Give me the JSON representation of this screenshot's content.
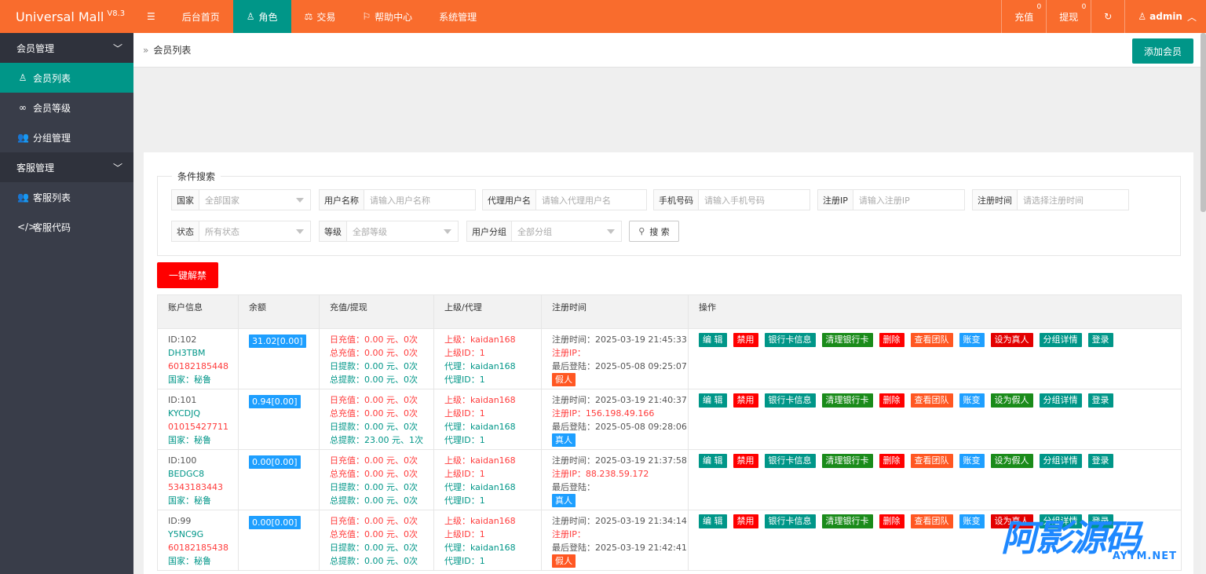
{
  "app": {
    "name": "Universal Mall",
    "version": "V8.3"
  },
  "topnav": {
    "menu_icon": "menu-icon",
    "items": [
      {
        "label": "后台首页",
        "active": false,
        "icon": ""
      },
      {
        "label": "角色",
        "active": true,
        "icon": "user-icon"
      },
      {
        "label": "交易",
        "active": false,
        "icon": "scale-icon"
      },
      {
        "label": "帮助中心",
        "active": false,
        "icon": "flag-icon"
      },
      {
        "label": "系统管理",
        "active": false,
        "icon": ""
      }
    ],
    "right": {
      "recharge_label": "充值",
      "recharge_count": "0",
      "withdraw_label": "提现",
      "withdraw_count": "0",
      "refresh_icon": "refresh-icon",
      "user_label": "admin"
    }
  },
  "sidebar": {
    "groups": [
      {
        "label": "会员管理",
        "items": [
          {
            "label": "会员列表",
            "icon": "user-icon",
            "active": true
          },
          {
            "label": "会员等级",
            "icon": "link-icon",
            "active": false
          },
          {
            "label": "分组管理",
            "icon": "users-icon",
            "active": false
          }
        ]
      },
      {
        "label": "客服管理",
        "items": [
          {
            "label": "客服列表",
            "icon": "users-icon",
            "active": false
          },
          {
            "label": "客服代码",
            "icon": "code-icon",
            "active": false
          }
        ]
      }
    ]
  },
  "breadcrumb": {
    "current": "会员列表"
  },
  "add_member_label": "添加会员",
  "search": {
    "legend": "条件搜索",
    "country": {
      "label": "国家",
      "value": "全部国家"
    },
    "username": {
      "label": "用户名称",
      "placeholder": "请输入用户名称"
    },
    "agent": {
      "label": "代理用户名",
      "placeholder": "请输入代理用户名"
    },
    "phone": {
      "label": "手机号码",
      "placeholder": "请输入手机号码"
    },
    "regip": {
      "label": "注册IP",
      "placeholder": "请输入注册IP"
    },
    "regtime": {
      "label": "注册时间",
      "placeholder": "请选择注册时间"
    },
    "status": {
      "label": "状态",
      "value": "所有状态"
    },
    "level": {
      "label": "等级",
      "value": "全部等级"
    },
    "group": {
      "label": "用户分组",
      "value": "全部分组"
    },
    "button": "搜 索"
  },
  "unban_label": "一键解禁",
  "table": {
    "headers": [
      "账户信息",
      "余额",
      "充值/提现",
      "上级/代理",
      "注册时间",
      "操作"
    ],
    "rows": [
      {
        "id": "ID:102",
        "username": "DH3TBM",
        "phone": "60182185448",
        "country": "国家：秘鲁",
        "balance": "31.02[0.00]",
        "day_recharge": "日充值：0.00 元、0次",
        "total_recharge": "总充值：0.00 元、0次",
        "day_withdraw": "日提款：0.00 元、0次",
        "total_withdraw": "总提款：0.00 元、0次",
        "parent": "上级：kaidan168",
        "parent_id": "上级ID：1",
        "agent": "代理：kaidan168",
        "agent_id": "代理ID：1",
        "reg_time": "注册时间：2025-03-19 21:45:33",
        "reg_ip": "注册IP：",
        "last_login": "最后登陆：2025-05-08 09:25:07",
        "type_tag": "假人",
        "type": "fake",
        "ops": [
          "编 辑",
          "禁用",
          "银行卡信息",
          "清理银行卡",
          "删除",
          "查看团队",
          "账变",
          "设为真人",
          "分组详情",
          "登录"
        ]
      },
      {
        "id": "ID:101",
        "username": "KYCDJQ",
        "phone": "01015427711",
        "country": "国家：秘鲁",
        "balance": "0.94[0.00]",
        "day_recharge": "日充值：0.00 元、0次",
        "total_recharge": "总充值：0.00 元、0次",
        "day_withdraw": "日提款：0.00 元、0次",
        "total_withdraw": "总提款：23.00 元、1次",
        "parent": "上级：kaidan168",
        "parent_id": "上级ID：1",
        "agent": "代理：kaidan168",
        "agent_id": "代理ID：1",
        "reg_time": "注册时间：2025-03-19 21:40:37",
        "reg_ip": "注册IP：156.198.49.166",
        "last_login": "最后登陆：2025-05-08 09:28:06",
        "type_tag": "真人",
        "type": "real",
        "ops": [
          "编 辑",
          "禁用",
          "银行卡信息",
          "清理银行卡",
          "删除",
          "查看团队",
          "账变",
          "设为假人",
          "分组详情",
          "登录"
        ]
      },
      {
        "id": "ID:100",
        "username": "BEDGC8",
        "phone": "5343183443",
        "country": "国家：秘鲁",
        "balance": "0.00[0.00]",
        "day_recharge": "日充值：0.00 元、0次",
        "total_recharge": "总充值：0.00 元、0次",
        "day_withdraw": "日提款：0.00 元、0次",
        "total_withdraw": "总提款：0.00 元、0次",
        "parent": "上级：kaidan168",
        "parent_id": "上级ID：1",
        "agent": "代理：kaidan168",
        "agent_id": "代理ID：1",
        "reg_time": "注册时间：2025-03-19 21:37:58",
        "reg_ip": "注册IP：88.238.59.172",
        "last_login": "最后登陆：",
        "type_tag": "真人",
        "type": "real",
        "ops": [
          "编 辑",
          "禁用",
          "银行卡信息",
          "清理银行卡",
          "删除",
          "查看团队",
          "账变",
          "设为假人",
          "分组详情",
          "登录"
        ]
      },
      {
        "id": "ID:99",
        "username": "Y5NC9G",
        "phone": "60182185438",
        "country": "国家：秘鲁",
        "balance": "0.00[0.00]",
        "day_recharge": "日充值：0.00 元、0次",
        "total_recharge": "总充值：0.00 元、0次",
        "day_withdraw": "日提款：0.00 元、0次",
        "total_withdraw": "总提款：0.00 元、0次",
        "parent": "上级：kaidan168",
        "parent_id": "上级ID：1",
        "agent": "代理：kaidan168",
        "agent_id": "代理ID：1",
        "reg_time": "注册时间：2025-03-19 21:34:14",
        "reg_ip": "注册IP：",
        "last_login": "最后登陆：2025-03-19 21:42:41",
        "type_tag": "假人",
        "type": "fake",
        "ops": [
          "编 辑",
          "禁用",
          "银行卡信息",
          "清理银行卡",
          "删除",
          "查看团队",
          "账变",
          "设为真人",
          "分组详情",
          "登录"
        ]
      }
    ]
  },
  "watermark": {
    "big": "阿影源码",
    "small": "AYYM.NET"
  },
  "colors": {
    "topbar": "#f96c2d",
    "sidebar": "#393d49",
    "accent": "#009688",
    "danger": "#ff0000",
    "info": "#1e9fff"
  }
}
